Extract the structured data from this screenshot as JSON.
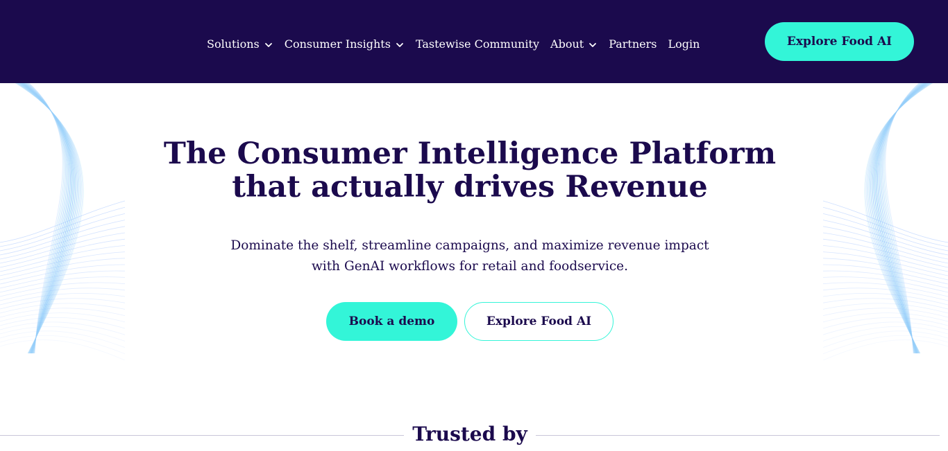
{
  "header": {
    "nav": [
      {
        "label": "Solutions",
        "has_dropdown": true
      },
      {
        "label": "Consumer Insights",
        "has_dropdown": true
      },
      {
        "label": "Tastewise Community",
        "has_dropdown": false
      },
      {
        "label": "About",
        "has_dropdown": true
      },
      {
        "label": "Partners",
        "has_dropdown": false
      },
      {
        "label": "Login",
        "has_dropdown": false
      }
    ],
    "cta_label": "Explore Food AI"
  },
  "hero": {
    "title_line1": "The Consumer Intelligence Platform",
    "title_line2": "that actually drives Revenue",
    "subtitle_line1": "Dominate the shelf, streamline campaigns, and maximize revenue impact",
    "subtitle_line2": "with GenAI workflows for retail and foodservice.",
    "primary_button": "Book a demo",
    "secondary_button": "Explore Food AI"
  },
  "trusted": {
    "title": "Trusted by"
  },
  "colors": {
    "brand_dark": "#1b0a4d",
    "accent": "#33f5d8",
    "wave_blue": "#8fb6ff",
    "wave_cyan": "#9ee8f5"
  },
  "icons": {
    "dropdown": "chevron-down-icon"
  }
}
